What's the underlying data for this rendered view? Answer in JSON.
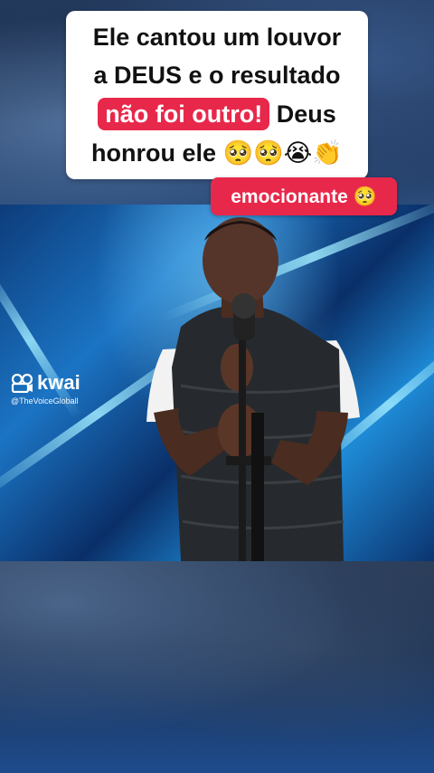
{
  "caption": {
    "line1": "Ele cantou um louvor",
    "line2": "a DEUS e o resultado",
    "line3_highlight": "não foi outro!",
    "line3_rest": " Deus",
    "line4_text": "honrou ele ",
    "line4_emojis": "🥺🥺😭👏"
  },
  "tag": {
    "text": "emocionante ",
    "emoji": "🥺"
  },
  "watermark": {
    "brand": "kwai",
    "handle": "@TheVoiceGloball"
  },
  "colors": {
    "highlight_red": "#e8284b",
    "caption_bg": "#ffffff",
    "stage_blue": "#1b74c4"
  }
}
